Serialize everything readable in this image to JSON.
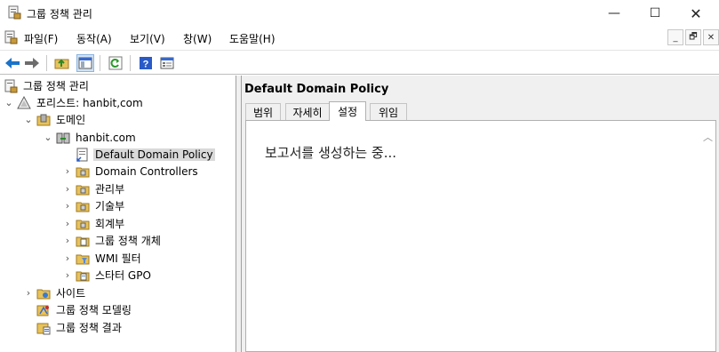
{
  "window": {
    "title": "그룹 정책 관리",
    "app_icon": "gpmc-icon",
    "controls": {
      "minimize": "—",
      "maximize": "☐",
      "close": "✕"
    }
  },
  "menubar": {
    "items": [
      "파일(F)",
      "동작(A)",
      "보기(V)",
      "창(W)",
      "도움말(H)"
    ],
    "mdi_controls": [
      "_",
      "🗗",
      "✕"
    ]
  },
  "toolbar": {
    "buttons": [
      "back-icon",
      "forward-icon",
      "up-folder-icon",
      "show-hide-tree-icon",
      "refresh-icon",
      "help-icon",
      "properties-icon"
    ]
  },
  "tree": {
    "root": "그룹 정책 관리",
    "forest": "포리스트: hanbit,com",
    "domains": "도메인",
    "domain": "hanbit.com",
    "items": [
      "Default Domain Policy",
      "Domain Controllers",
      "관리부",
      "기술부",
      "회계부",
      "그룹 정책 개체",
      "WMI 필터",
      "스타터 GPO"
    ],
    "sites": "사이트",
    "modeling": "그룹 정책 모델링",
    "results": "그룹 정책 결과"
  },
  "details": {
    "heading": "Default Domain Policy",
    "tabs": [
      "범위",
      "자세히",
      "설정",
      "위임"
    ],
    "active_tab": "설정",
    "message": "보고서를 생성하는 중..."
  },
  "colors": {
    "selection": "#d9d9d9",
    "back_arrow": "#1a73c8",
    "forward_arrow": "#6d6d6d",
    "folder": "#e8c25a"
  }
}
